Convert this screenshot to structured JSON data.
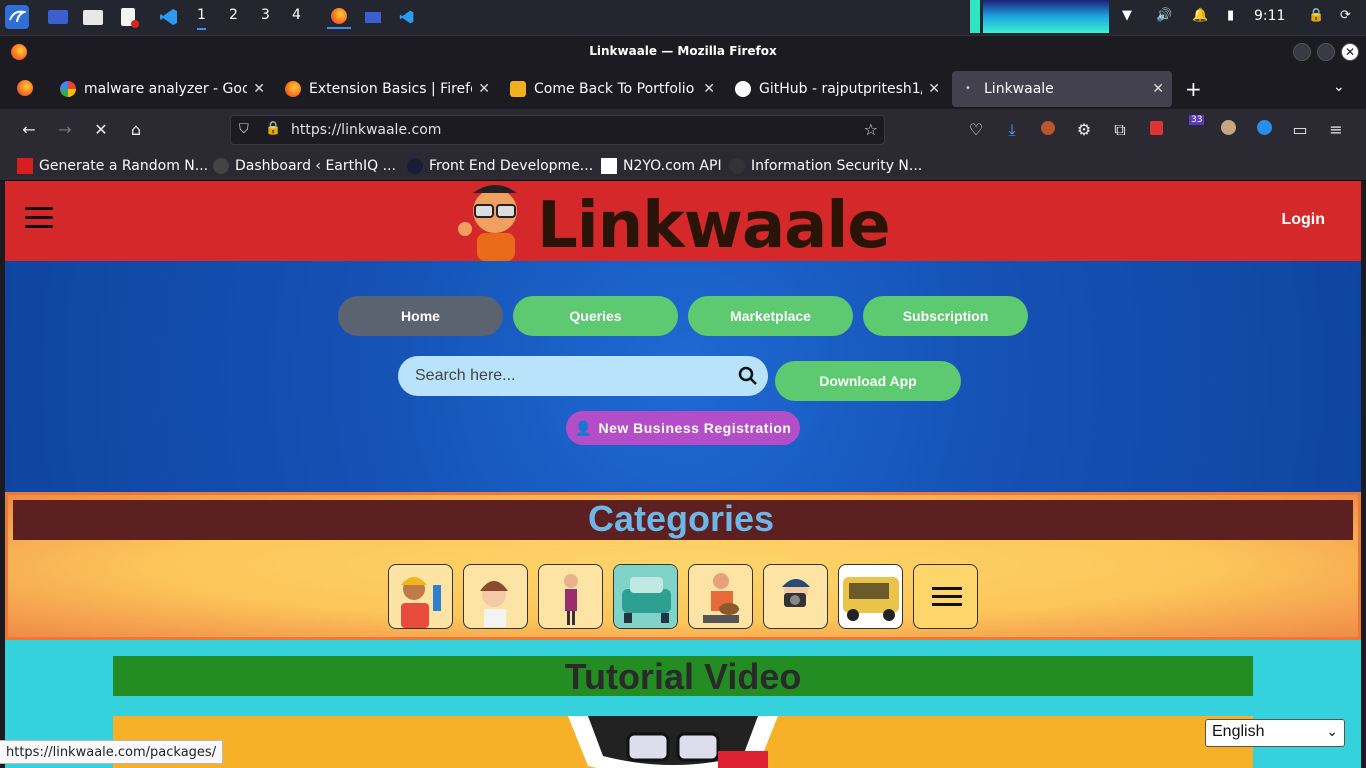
{
  "taskbar": {
    "workspaces": [
      "1",
      "2",
      "3",
      "4"
    ],
    "clock": "9:11"
  },
  "window": {
    "title": "Linkwaale — Mozilla Firefox"
  },
  "tabs": [
    {
      "label": "malware analyzer - Googl"
    },
    {
      "label": "Extension Basics | Firefox"
    },
    {
      "label": "Come Back To Portfolio"
    },
    {
      "label": "GitHub - rajputpritesh1/M"
    },
    {
      "label": "Linkwaale"
    }
  ],
  "urlbar": {
    "url": "https://linkwaale.com"
  },
  "toolbar": {
    "extension_badge": "33"
  },
  "bookmarks": [
    {
      "label": "Generate a Random N..."
    },
    {
      "label": "Dashboard ‹ EarthIQ ..."
    },
    {
      "label": "Front End Developme..."
    },
    {
      "label": "N2YO.com API"
    },
    {
      "label": "Information Security N..."
    }
  ],
  "site": {
    "logo_text": "Linkwaale",
    "login_label": "Login",
    "nav": [
      {
        "label": "Home"
      },
      {
        "label": "Queries"
      },
      {
        "label": "Marketplace"
      },
      {
        "label": "Subscription"
      }
    ],
    "search_placeholder": "Search here...",
    "download_label": "Download App",
    "new_business_label": "New Business Registration",
    "categories_title": "Categories",
    "tutorial_title": "Tutorial Video",
    "language": "English"
  },
  "status_url": "https://linkwaale.com/packages/",
  "colors": {
    "header_red": "#d4282a",
    "pill_green": "#5dc970",
    "pill_home": "#5c6370",
    "new_business_purple": "#b44ec8",
    "tutorial_green": "#238c23"
  }
}
